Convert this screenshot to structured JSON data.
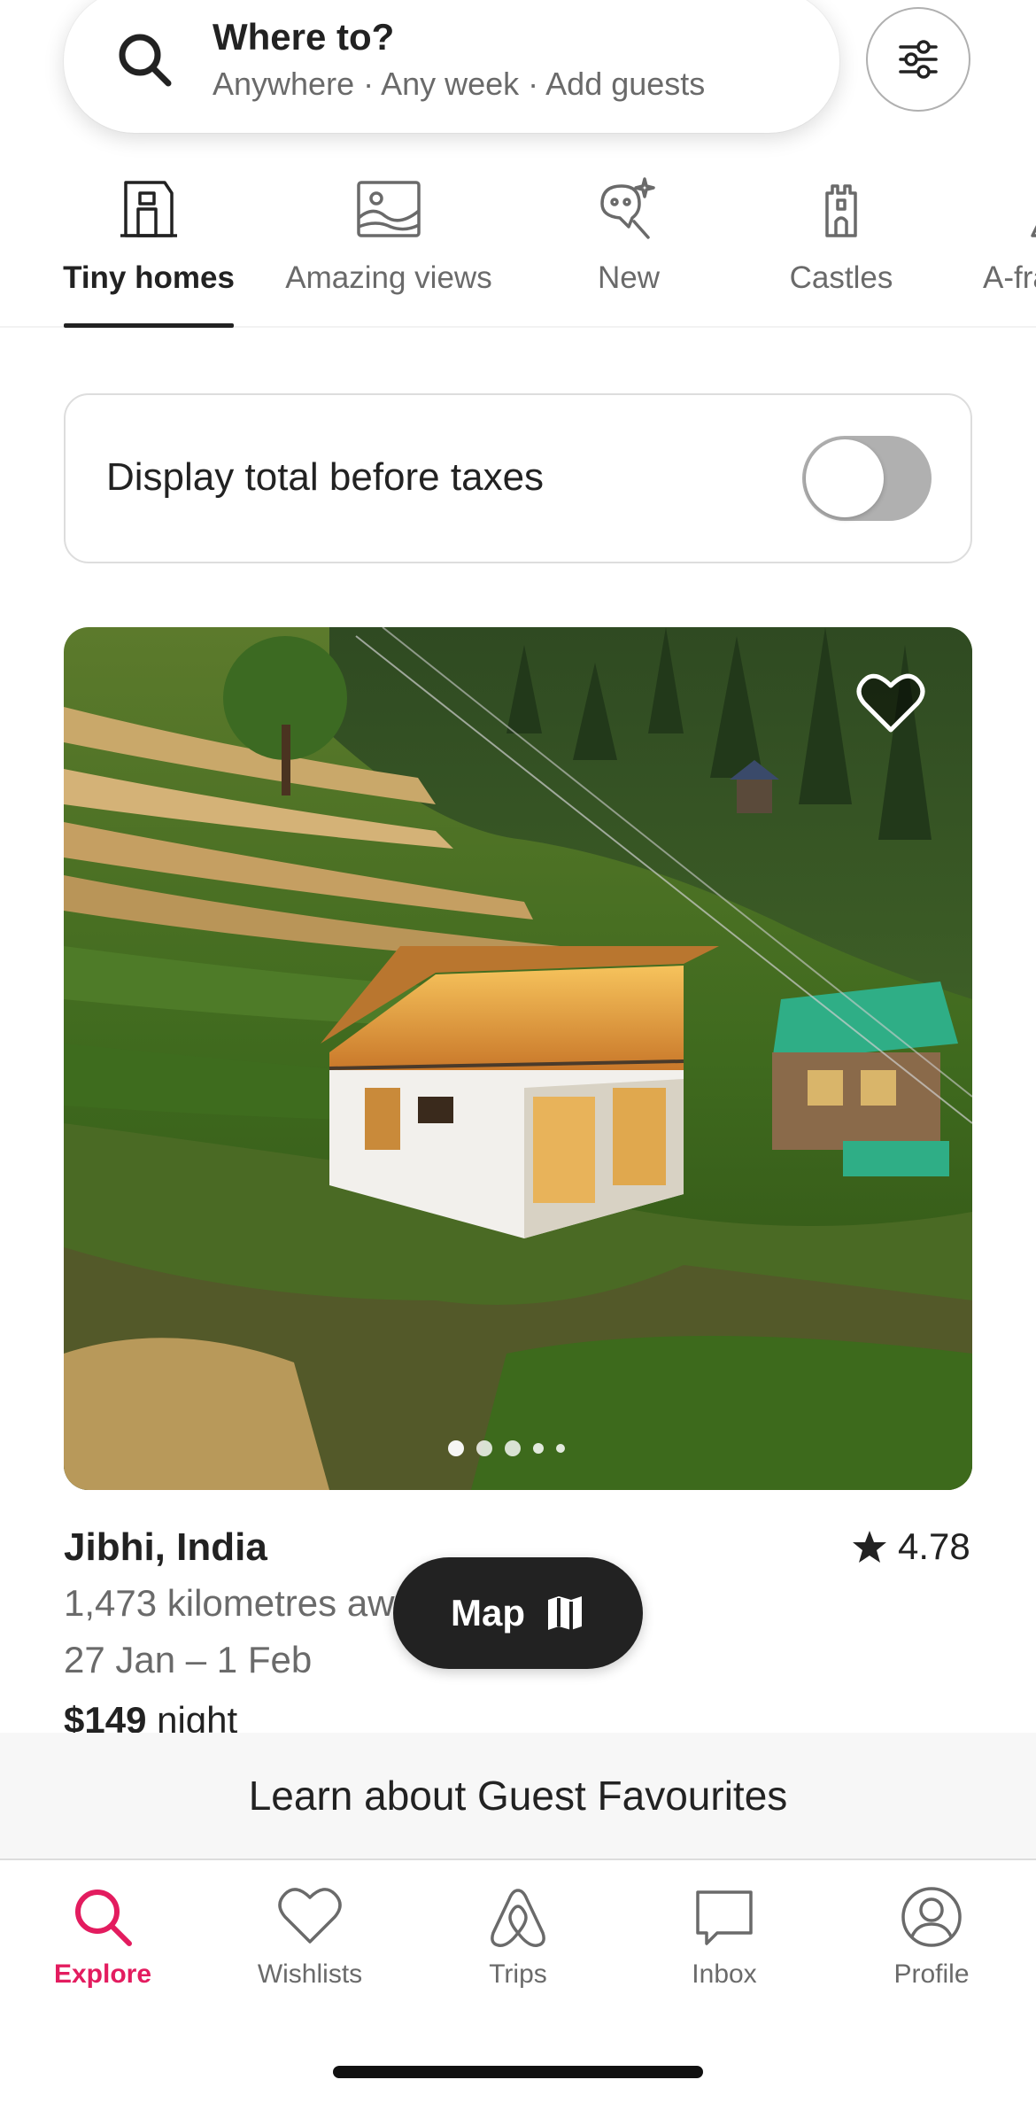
{
  "search": {
    "title": "Where to?",
    "subtitle": "Anywhere · Any week · Add guests"
  },
  "categories": [
    {
      "label": "Tiny homes",
      "icon": "tiny-home-icon",
      "active": true
    },
    {
      "label": "Amazing views",
      "icon": "amazing-views-icon",
      "active": false
    },
    {
      "label": "New",
      "icon": "new-sparkle-icon",
      "active": false
    },
    {
      "label": "Castles",
      "icon": "castle-icon",
      "active": false
    },
    {
      "label": "A-frames",
      "icon": "a-frame-icon",
      "active": false
    }
  ],
  "price_toggle": {
    "label": "Display total before taxes",
    "enabled": false
  },
  "listing": {
    "location": "Jibhi, India",
    "rating": "4.78",
    "distance": "1,473 kilometres away",
    "dates": "27 Jan – 1 Feb",
    "price": "$149",
    "price_unit": "night",
    "photo_count": 5,
    "current_photo": 1,
    "wishlisted": false
  },
  "map_button": {
    "label": "Map",
    "icon": "map-icon"
  },
  "guest_favourites_banner": {
    "label": "Learn about Guest Favourites"
  },
  "bottom_nav": [
    {
      "label": "Explore",
      "icon": "search-icon",
      "active": true
    },
    {
      "label": "Wishlists",
      "icon": "heart-icon",
      "active": false
    },
    {
      "label": "Trips",
      "icon": "airbnb-logo-icon",
      "active": false
    },
    {
      "label": "Inbox",
      "icon": "message-icon",
      "active": false
    },
    {
      "label": "Profile",
      "icon": "profile-icon",
      "active": false
    }
  ],
  "colors": {
    "brand": "#e31c5f",
    "text_primary": "#222222",
    "text_secondary": "#6a6a6a",
    "toggle_off": "#b0b0b0"
  }
}
